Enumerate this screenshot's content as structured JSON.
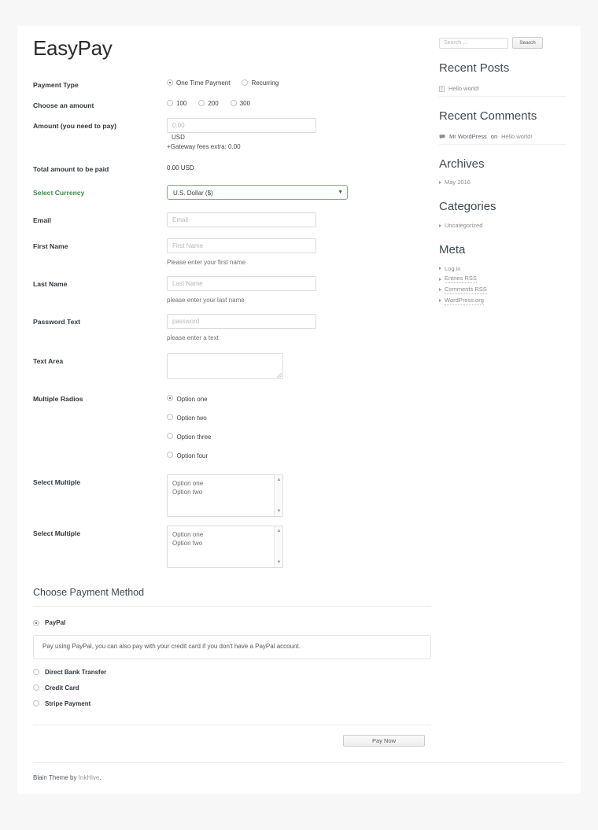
{
  "site": {
    "title": "EasyPay",
    "footer_prefix": "Blain Theme by ",
    "footer_link": "InkHive",
    "footer_suffix": "."
  },
  "form": {
    "payment_type": {
      "label": "Payment Type",
      "options": [
        {
          "label": "One Time Payment",
          "checked": true
        },
        {
          "label": "Recurring",
          "checked": false
        }
      ]
    },
    "choose_amount": {
      "label": "Choose an amount",
      "options": [
        {
          "label": "100",
          "checked": false
        },
        {
          "label": "200",
          "checked": false
        },
        {
          "label": "300",
          "checked": false
        }
      ]
    },
    "amount": {
      "label": "Amount (you need to pay)",
      "placeholder": "0.00",
      "value": "",
      "currency_code": "USD",
      "gateway_note": "+Gateway fees extra: 0.00"
    },
    "total": {
      "label": "Total amount to be paid",
      "value": "0.00  USD"
    },
    "currency": {
      "label": "Select Currency",
      "selected": "U.S. Dollar ($)",
      "arrow": "chevron-down-icon"
    },
    "email": {
      "label": "Email",
      "placeholder": "Email",
      "value": ""
    },
    "first_name": {
      "label": "First Name",
      "placeholder": "First Name",
      "value": "",
      "help": "Please enter your first name"
    },
    "last_name": {
      "label": "Last Name",
      "placeholder": "Last Name",
      "value": "",
      "help": "please enter your last name"
    },
    "password_text": {
      "label": "Password Text",
      "placeholder": "password",
      "value": "",
      "help": "please enter a text"
    },
    "text_area": {
      "label": "Text Area",
      "value": ""
    },
    "multiple_radios": {
      "label": "Multiple Radios",
      "options": [
        {
          "label": "Option one",
          "checked": true
        },
        {
          "label": "Option two",
          "checked": false
        },
        {
          "label": "Option three",
          "checked": false
        },
        {
          "label": "Option four",
          "checked": false
        }
      ]
    },
    "select_multiple_1": {
      "label": "Select Multiple",
      "options": [
        "Option one",
        "Option two"
      ]
    },
    "select_multiple_2": {
      "label": "Select Multiple",
      "options": [
        "Option one",
        "Option two"
      ]
    }
  },
  "payment_method": {
    "heading": "Choose Payment Method",
    "methods": [
      {
        "label": "PayPal",
        "checked": true
      },
      {
        "label": "Direct Bank Transfer",
        "checked": false
      },
      {
        "label": "Credit Card",
        "checked": false
      },
      {
        "label": "Stripe Payment",
        "checked": false
      }
    ],
    "paypal_description": "Pay using PayPal, you can also pay with your credit card if you don't have a PayPal account.",
    "pay_button": "Pay Now"
  },
  "sidebar": {
    "search": {
      "placeholder": "Search …",
      "value": "",
      "button": "Search"
    },
    "recent_posts": {
      "title": "Recent Posts",
      "items": [
        {
          "icon": "post-page-icon",
          "label": "Hello world!"
        }
      ]
    },
    "recent_comments": {
      "title": "Recent Comments",
      "items": [
        {
          "icon": "comment-bubble-icon",
          "author": "Mr WordPress",
          "connector": "on",
          "post": "Hello world!"
        }
      ]
    },
    "archives": {
      "title": "Archives",
      "items": [
        "May 2016"
      ]
    },
    "categories": {
      "title": "Categories",
      "items": [
        "Uncategorized"
      ]
    },
    "meta": {
      "title": "Meta",
      "items": [
        "Log in",
        "Entries RSS",
        "Comments RSS",
        "WordPress.org"
      ]
    }
  },
  "colors": {
    "page_bg": "#f7f7f7",
    "container_bg": "#ffffff",
    "label": "#31373d",
    "accent_green": "#3d8b4a",
    "select_border": "#7fb285",
    "muted": "#8b8b8b"
  }
}
